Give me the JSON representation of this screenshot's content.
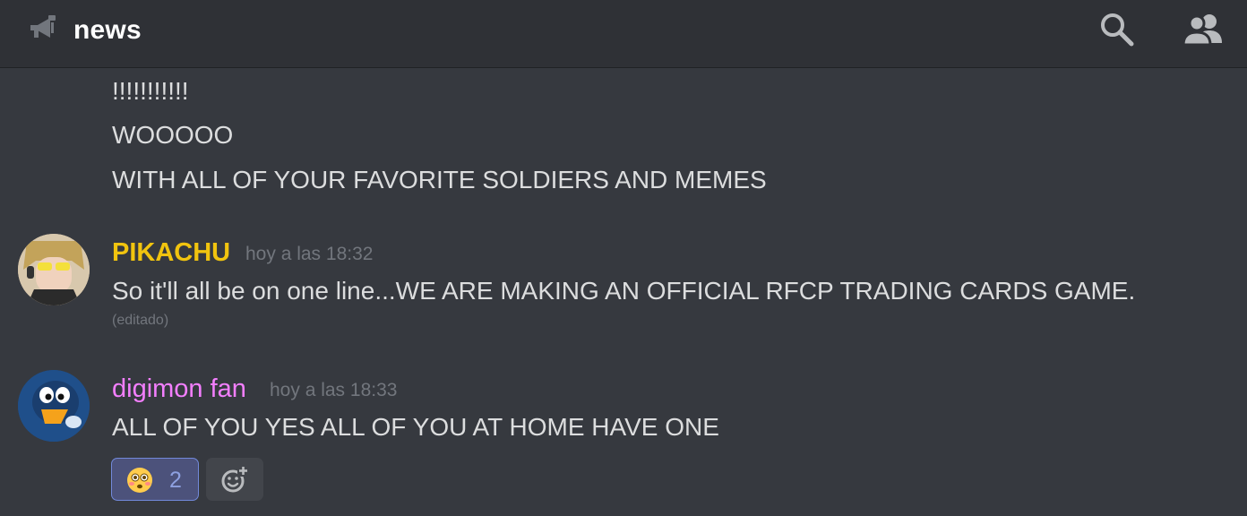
{
  "header": {
    "channel_name": "news",
    "icons": {
      "channel": "megaphone-icon",
      "search": "search-icon",
      "members": "members-icon"
    }
  },
  "messages": [
    {
      "type": "continuation",
      "lines": [
        "!!!!!!!!!!!",
        "WOOOOO",
        "WITH ALL OF YOUR FAVORITE SOLDIERS AND MEMES"
      ]
    },
    {
      "author": "PIKACHU",
      "author_color": "#f1c40f",
      "timestamp": "hoy a las 18:32",
      "text": "So it'll all be on one line...WE ARE MAKING AN OFFICIAL RFCP TRADING CARDS GAME.",
      "edited_label": "(editado)"
    },
    {
      "author": "digimon fan",
      "author_color": "#f47fff",
      "timestamp": "hoy a las 18:33",
      "text": "ALL OF YOU YES ALL OF YOU AT HOME HAVE ONE",
      "reactions": [
        {
          "emoji": "flushed-face-emoji",
          "count": "2"
        }
      ],
      "add_reaction_icon": "add-reaction-icon"
    }
  ],
  "colors": {
    "background": "#36393f",
    "header": "#2f3136",
    "text": "#dcddde",
    "muted": "#72767d",
    "reaction_bg": "#4c527b",
    "reaction_border": "#7289da"
  }
}
